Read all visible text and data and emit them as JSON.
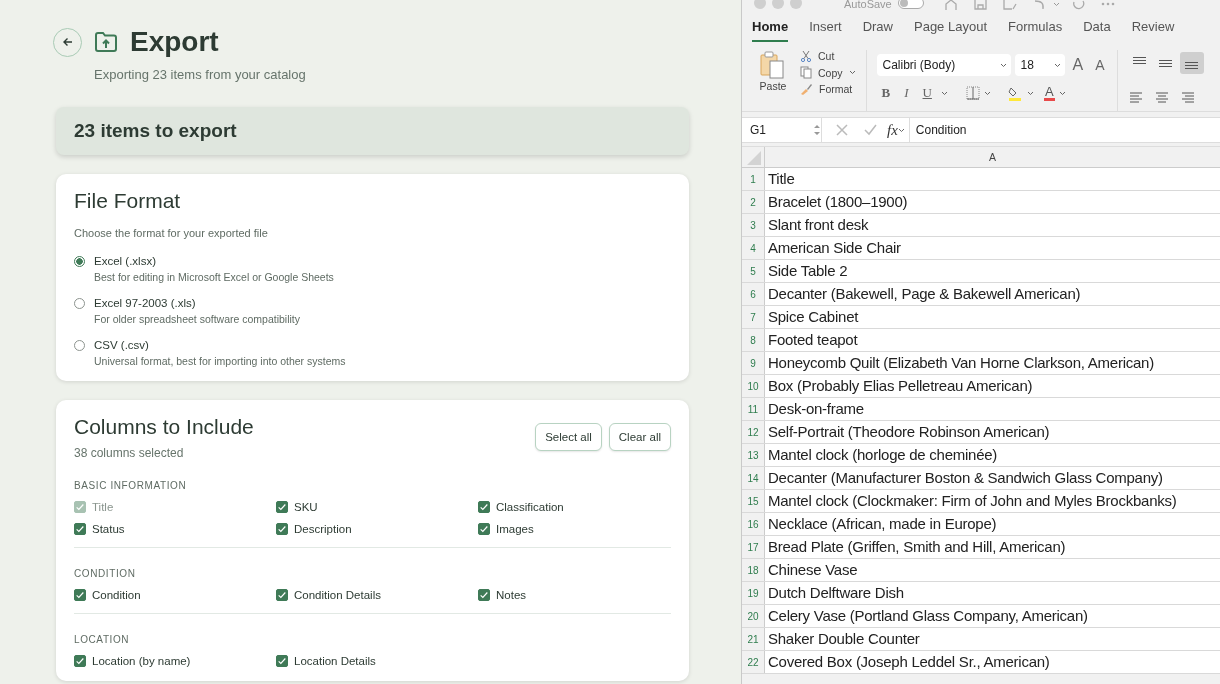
{
  "export": {
    "title": "Export",
    "subtitle": "Exporting 23 items from your catalog",
    "summary": "23 items to export",
    "file_format": {
      "title": "File Format",
      "description": "Choose the format for your exported file",
      "options": [
        {
          "label": "Excel (.xlsx)",
          "description": "Best for editing in Microsoft Excel or Google Sheets",
          "selected": true
        },
        {
          "label": "Excel 97-2003 (.xls)",
          "description": "For older spreadsheet software compatibility",
          "selected": false
        },
        {
          "label": "CSV (.csv)",
          "description": "Universal format, best for importing into other systems",
          "selected": false
        }
      ]
    },
    "columns": {
      "title": "Columns to Include",
      "count": "38 columns selected",
      "buttons": [
        "Select all",
        "Clear all"
      ],
      "groups": [
        {
          "heading": "BASIC INFORMATION",
          "items": [
            {
              "label": "Title",
              "checked": true,
              "disabled": true
            },
            {
              "label": "SKU",
              "checked": true,
              "disabled": false
            },
            {
              "label": "Classification",
              "checked": true,
              "disabled": false
            },
            {
              "label": "Status",
              "checked": true,
              "disabled": false
            },
            {
              "label": "Description",
              "checked": true,
              "disabled": false
            },
            {
              "label": "Images",
              "checked": true,
              "disabled": false
            }
          ]
        },
        {
          "heading": "CONDITION",
          "items": [
            {
              "label": "Condition",
              "checked": true,
              "disabled": false
            },
            {
              "label": "Condition Details",
              "checked": true,
              "disabled": false
            },
            {
              "label": "Notes",
              "checked": true,
              "disabled": false
            }
          ]
        },
        {
          "heading": "LOCATION",
          "items": [
            {
              "label": "Location (by name)",
              "checked": true,
              "disabled": false
            },
            {
              "label": "Location Details",
              "checked": true,
              "disabled": false
            }
          ]
        }
      ]
    }
  },
  "excel": {
    "autosave": {
      "label": "AutoSave",
      "on": false
    },
    "tabs": [
      {
        "label": "Home",
        "selected": true
      },
      {
        "label": "Insert",
        "selected": false
      },
      {
        "label": "Draw",
        "selected": false
      },
      {
        "label": "Page Layout",
        "selected": false
      },
      {
        "label": "Formulas",
        "selected": false
      },
      {
        "label": "Data",
        "selected": false
      },
      {
        "label": "Review",
        "selected": false
      }
    ],
    "clipboard": {
      "paste": "Paste",
      "cut": "Cut",
      "copy": "Copy",
      "format": "Format"
    },
    "font": "Calibri (Body)",
    "font_size": "18",
    "grow_font": "A",
    "shrink_font": "A",
    "styles": [
      "B",
      "I",
      "U"
    ],
    "font_color": "A",
    "vertical_align": [
      {
        "selected": false
      },
      {
        "selected": false
      },
      {
        "selected": true
      }
    ],
    "name_box": "G1",
    "fx": "fx",
    "formula": "Condition",
    "column": "A",
    "rows": [
      {
        "number": "1",
        "value": "Title"
      },
      {
        "number": "2",
        "value": "Bracelet (1800–1900)"
      },
      {
        "number": "3",
        "value": "Slant front desk"
      },
      {
        "number": "4",
        "value": "American Side Chair"
      },
      {
        "number": "5",
        "value": "Side Table 2"
      },
      {
        "number": "6",
        "value": "Decanter (Bakewell, Page & Bakewell American)"
      },
      {
        "number": "7",
        "value": "Spice Cabinet"
      },
      {
        "number": "8",
        "value": "Footed teapot"
      },
      {
        "number": "9",
        "value": "Honeycomb Quilt (Elizabeth Van Horne Clarkson, American)"
      },
      {
        "number": "10",
        "value": "Box (Probably Elias Pelletreau American)"
      },
      {
        "number": "11",
        "value": "Desk-on-frame"
      },
      {
        "number": "12",
        "value": "Self-Portrait (Theodore Robinson American)"
      },
      {
        "number": "13",
        "value": "Mantel clock (horloge de cheminée)"
      },
      {
        "number": "14",
        "value": "Decanter (Manufacturer Boston & Sandwich Glass Company)"
      },
      {
        "number": "15",
        "value": "Mantel clock (Clockmaker: Firm of John and Myles Brockbanks)"
      },
      {
        "number": "16",
        "value": "Necklace (African, made in Europe)"
      },
      {
        "number": "17",
        "value": "Bread Plate (Griffen, Smith and Hill, American)"
      },
      {
        "number": "18",
        "value": "Chinese Vase"
      },
      {
        "number": "19",
        "value": "Dutch Delftware Dish"
      },
      {
        "number": "20",
        "value": "Celery Vase (Portland Glass Company, American)"
      },
      {
        "number": "21",
        "value": "Shaker Double Counter"
      },
      {
        "number": "22",
        "value": "Covered Box (Joseph Leddel Sr., American)"
      }
    ]
  }
}
